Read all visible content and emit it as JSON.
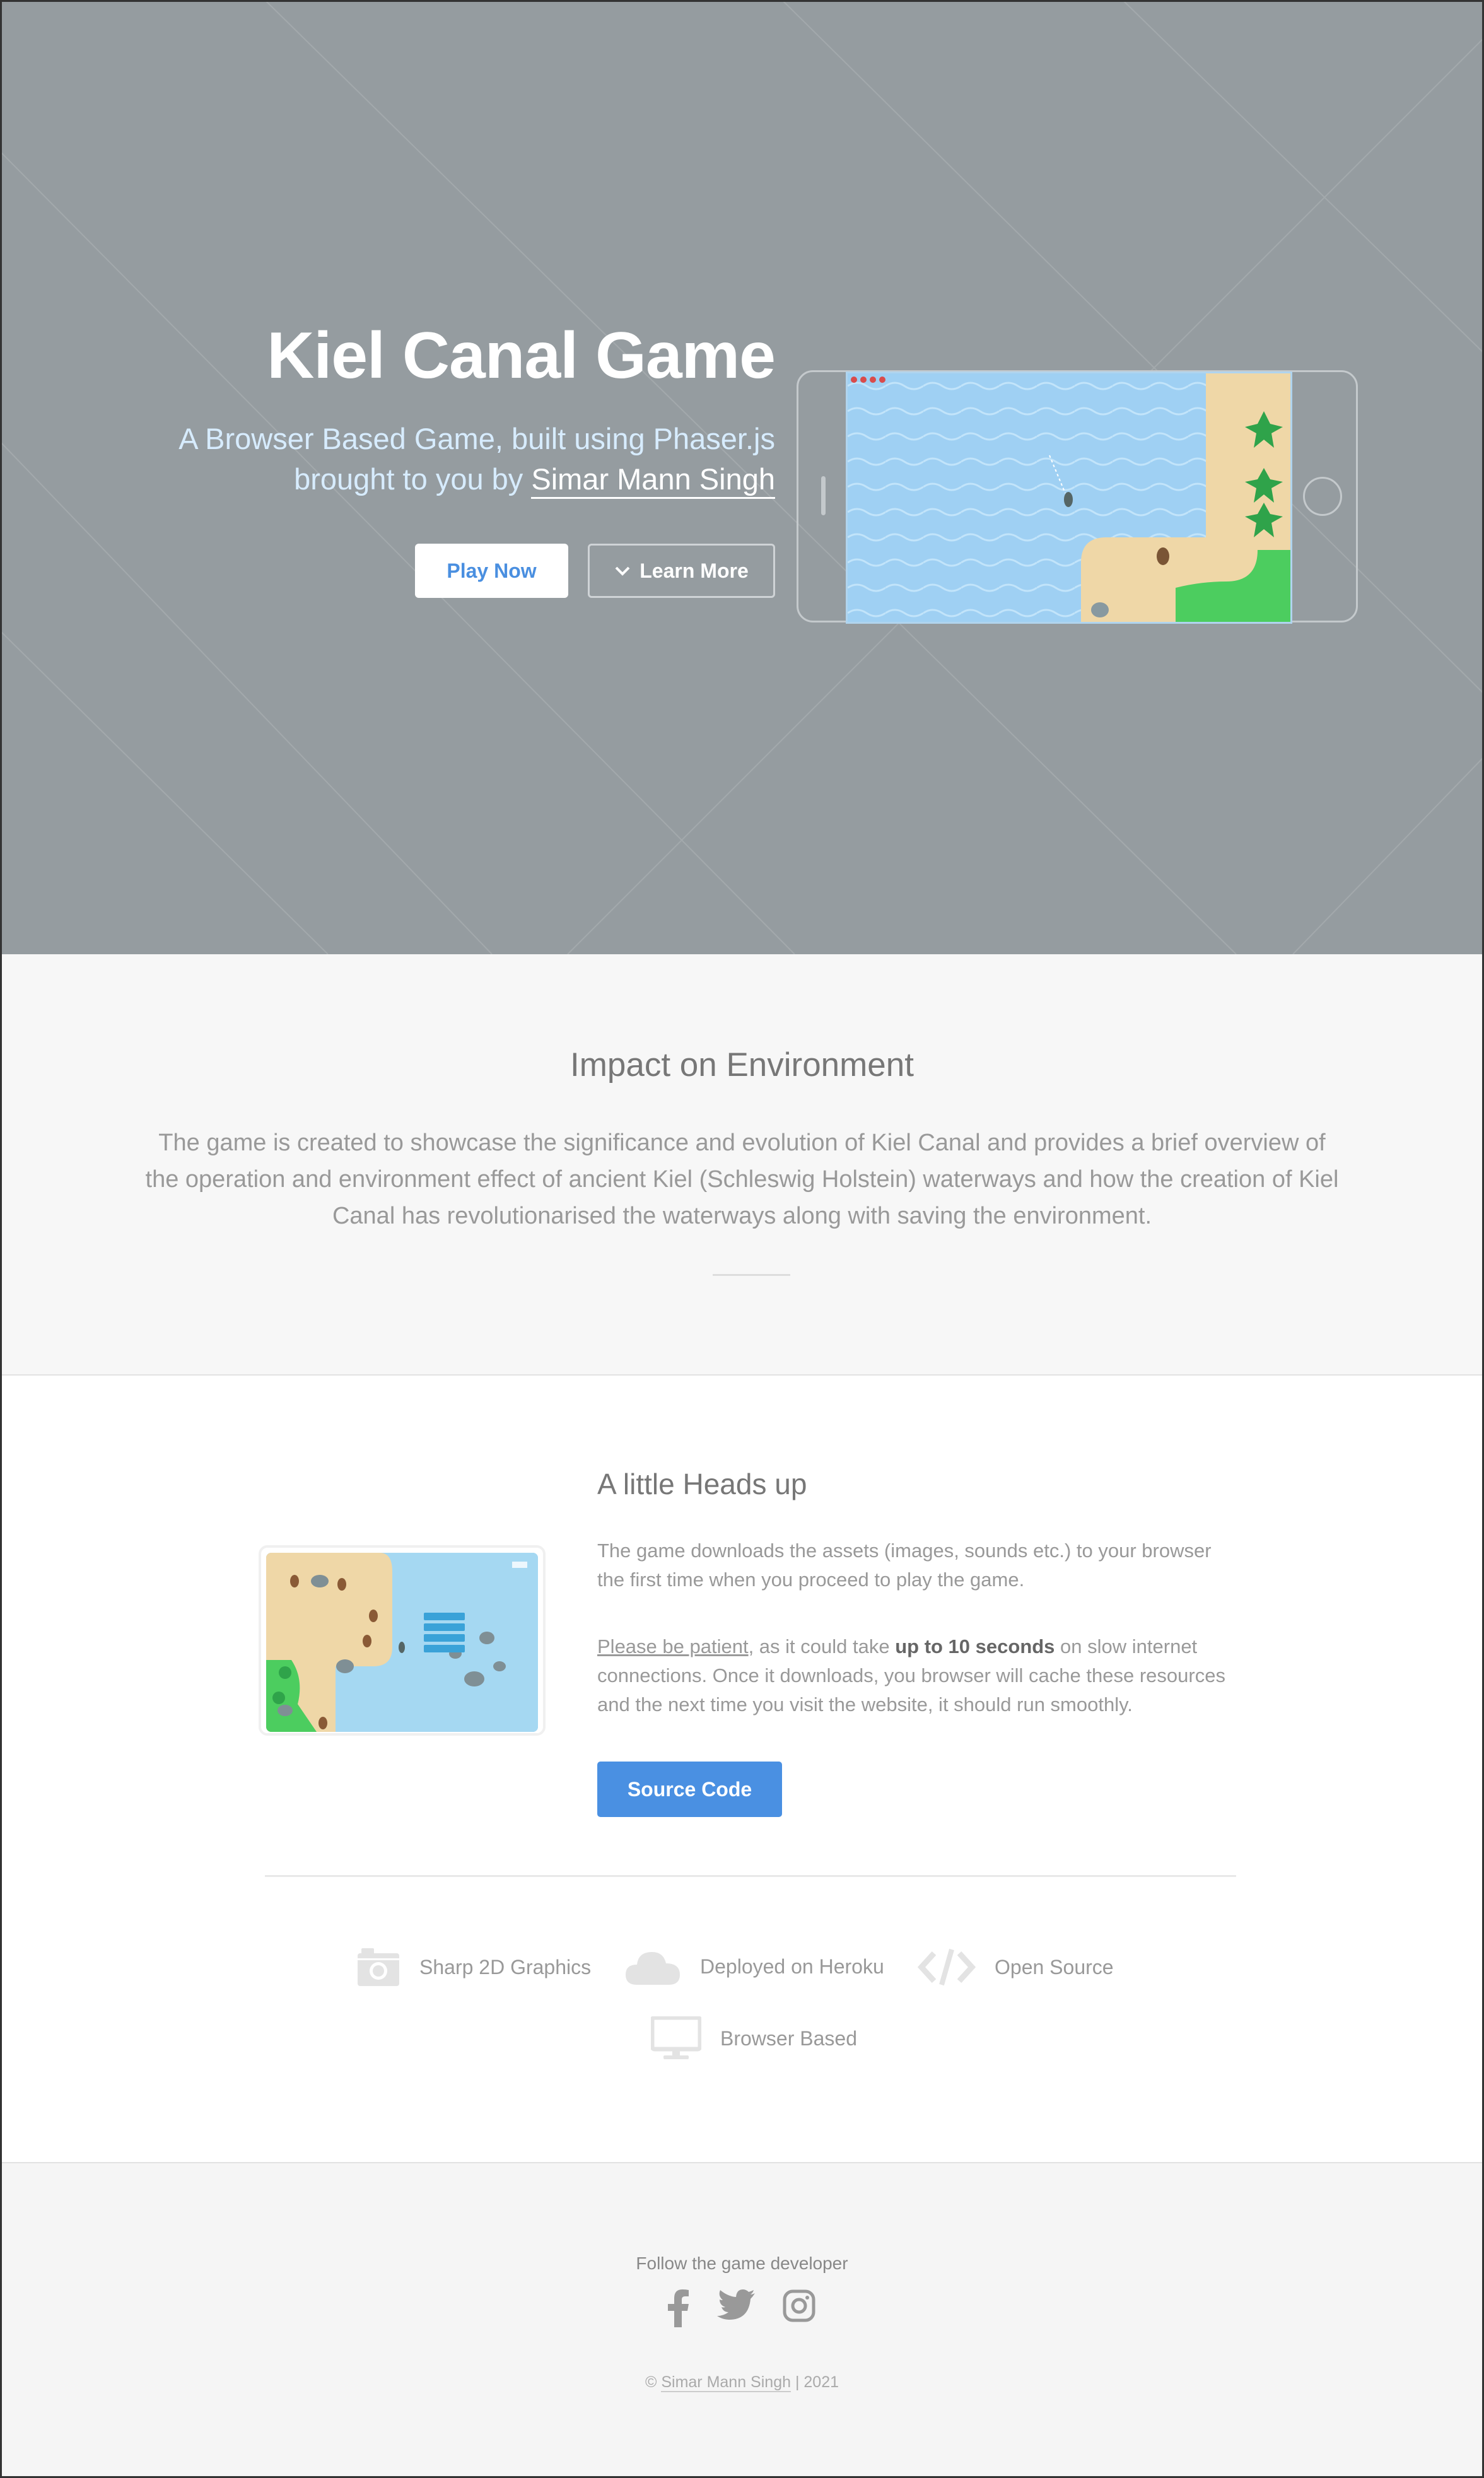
{
  "hero": {
    "title": "Kiel Canal Game",
    "subtitle_line1": "A Browser Based Game, built using Phaser.js",
    "subtitle_line2_prefix": "brought to you by ",
    "author": "Simar Mann Singh",
    "play_button": "Play Now",
    "learn_button": "Learn More",
    "bg_color": "#959ca0"
  },
  "environment": {
    "heading": "Impact on Environment",
    "body": "The game is created to showcase the significance and evolution of Kiel Canal and provides a brief overview of the operation and environment effect of ancient Kiel (Schleswig Holstein) waterways and how the creation of Kiel Canal has revolutionarised the waterways along with saving the environment."
  },
  "heads_up": {
    "heading": "A little Heads up",
    "p1": "The game downloads the assets (images, sounds etc.) to your browser the first time when you proceed to play the game.",
    "p2_link": "Please be patient",
    "p2_a": ", as it could take ",
    "p2_bold": "up to 10 seconds",
    "p2_b": " on slow internet connections. Once it downloads, you browser will cache these resources and the next time you visit the website, it should run smoothly.",
    "source_button": "Source Code",
    "accent": "#4a90e2"
  },
  "features": [
    {
      "label": "Sharp 2D Graphics",
      "icon": "camera-icon"
    },
    {
      "label": "Deployed on Heroku",
      "icon": "cloud-icon"
    },
    {
      "label": "Open Source",
      "icon": "code-icon"
    },
    {
      "label": "Browser Based",
      "icon": "monitor-icon"
    }
  ],
  "footer": {
    "follow": "Follow the game developer",
    "copy_prefix": "© ",
    "author": "Simar Mann Singh",
    "copy_suffix": " | 2021",
    "socials": [
      "facebook-icon",
      "twitter-icon",
      "instagram-icon"
    ]
  }
}
